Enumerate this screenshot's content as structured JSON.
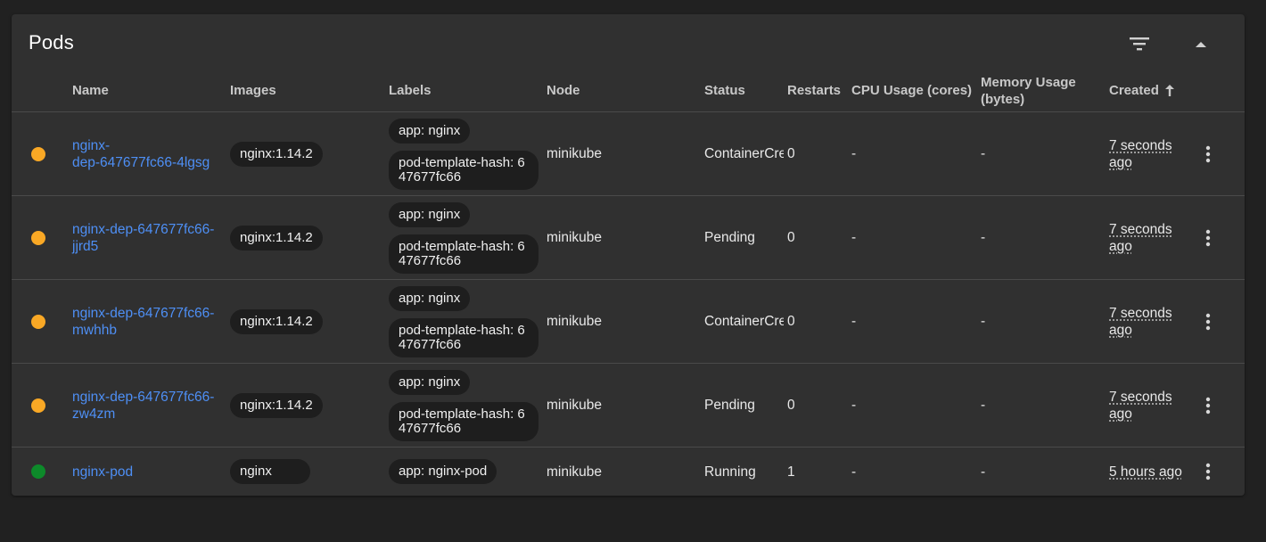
{
  "title": "Pods",
  "colors": {
    "pending": "#f9a825",
    "running": "#0d8a2a",
    "link": "#4e8ff5"
  },
  "columns": {
    "name": "Name",
    "images": "Images",
    "labels": "Labels",
    "node": "Node",
    "status": "Status",
    "restarts": "Restarts",
    "cpu": "CPU Usage (cores)",
    "memory_line1": "Memory Usage",
    "memory_line2": "(bytes)",
    "created": "Created"
  },
  "icons": {
    "filter": "filter-icon",
    "collapse": "collapse-up-icon",
    "sort": "arrow-up-icon",
    "row_menu": "more-vert-icon"
  },
  "rows": [
    {
      "name_line1": "nginx-",
      "name_line2": "dep-647677fc66-4lgsg",
      "image": "nginx:1.14.2",
      "label1": "app: nginx",
      "label2": "pod-template-hash: 647677fc66",
      "node": "minikube",
      "status": "ContainerCreating",
      "restarts": "0",
      "cpu": "-",
      "memory": "-",
      "created_line1": "7 seconds",
      "created_line2": "ago",
      "state": "pending"
    },
    {
      "name_line1": "nginx-dep-647677fc66-",
      "name_line2": "jjrd5",
      "image": "nginx:1.14.2",
      "label1": "app: nginx",
      "label2": "pod-template-hash: 647677fc66",
      "node": "minikube",
      "status": "Pending",
      "restarts": "0",
      "cpu": "-",
      "memory": "-",
      "created_line1": "7 seconds",
      "created_line2": "ago",
      "state": "pending"
    },
    {
      "name_line1": "nginx-dep-647677fc66-",
      "name_line2": "mwhhb",
      "image": "nginx:1.14.2",
      "label1": "app: nginx",
      "label2": "pod-template-hash: 647677fc66",
      "node": "minikube",
      "status": "ContainerCreating",
      "restarts": "0",
      "cpu": "-",
      "memory": "-",
      "created_line1": "7 seconds",
      "created_line2": "ago",
      "state": "pending"
    },
    {
      "name_line1": "nginx-dep-647677fc66-",
      "name_line2": "zw4zm",
      "image": "nginx:1.14.2",
      "label1": "app: nginx",
      "label2": "pod-template-hash: 647677fc66",
      "node": "minikube",
      "status": "Pending",
      "restarts": "0",
      "cpu": "-",
      "memory": "-",
      "created_line1": "7 seconds",
      "created_line2": "ago",
      "state": "pending"
    },
    {
      "name_line1": "nginx-pod",
      "image": "nginx",
      "label1": "app: nginx-pod",
      "node": "minikube",
      "status": "Running",
      "restarts": "1",
      "cpu": "-",
      "memory": "-",
      "created_line1": "5 hours ago",
      "state": "running"
    }
  ]
}
